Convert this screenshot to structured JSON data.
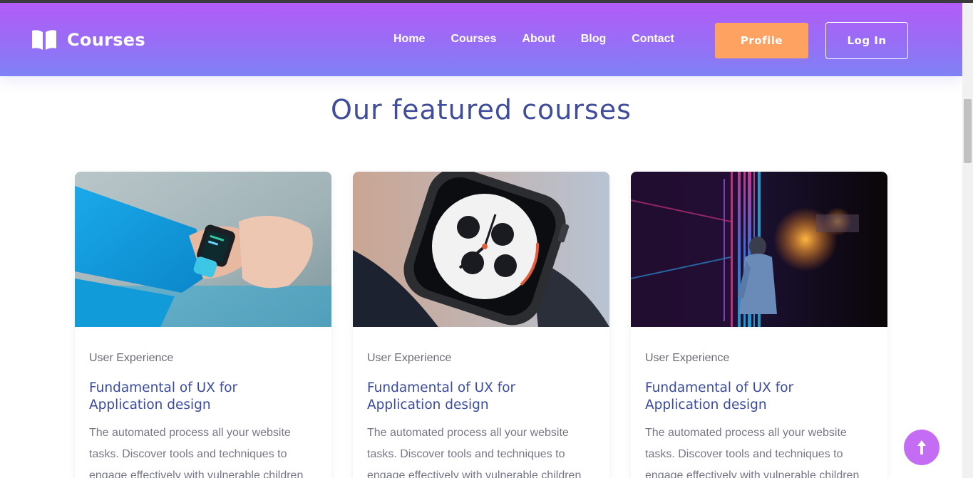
{
  "navbar": {
    "brand": {
      "name": "Courses",
      "icon": "open-book-icon"
    },
    "links": [
      "Home",
      "Courses",
      "About",
      "Blog",
      "Contact"
    ],
    "profile_label": "Profile",
    "login_label": "Log In"
  },
  "section": {
    "title": "Our featured courses"
  },
  "cards": [
    {
      "image": "smartwatch-wrist-photo",
      "category": "User Experience",
      "title": "Fundamental of UX for Application design",
      "description": "The automated process all your website tasks. Discover tools and techniques to engage effectively with vulnerable children"
    },
    {
      "image": "smartwatch-closeup-photo",
      "category": "User Experience",
      "title": "Fundamental of UX for Application design",
      "description": "The automated process all your website tasks. Discover tools and techniques to engage effectively with vulnerable children"
    },
    {
      "image": "neon-lights-person-photo",
      "category": "User Experience",
      "title": "Fundamental of UX for Application design",
      "description": "The automated process all your website tasks. Discover tools and techniques to engage effectively with vulnerable children"
    }
  ],
  "colors": {
    "nav_gradient_top": "#b25cf7",
    "nav_gradient_bottom": "#7f82f5",
    "profile_button": "#fda260",
    "title_text": "#3f4d9a",
    "back_to_top": "#c46cf3"
  },
  "back_to_top": {
    "icon": "arrow-up-icon"
  }
}
